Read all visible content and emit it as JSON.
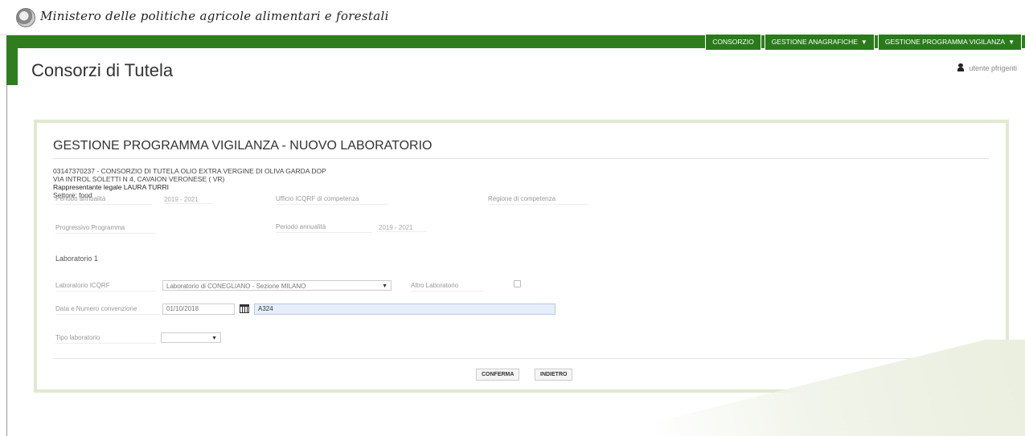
{
  "header": {
    "ministry": "Ministero delle politiche agricole alimentari e forestali",
    "menu": [
      {
        "label": "CONSORZIO",
        "caret": false
      },
      {
        "label": "GESTIONE ANAGRAFICHE",
        "caret": true
      },
      {
        "label": "GESTIONE PROGRAMMA VIGILANZA",
        "caret": true
      }
    ],
    "page_title": "Consorzi di Tutela",
    "user": "utente pfrigenti"
  },
  "panel": {
    "title": "GESTIONE PROGRAMMA VIGILANZA - NUOVO LABORATORIO",
    "info": [
      "03147370237 - CONSORZIO DI TUTELA OLIO EXTRA VERGINE DI OLIVA GARDA DOP",
      "VIA INTROL SOLETTI N 4, CAVAION VERONESE ( VR)",
      "Rappresentante legale LAURA TURRI",
      "Settore: food"
    ],
    "fields": {
      "periodo1_label": "Periodo annualità",
      "periodo1_value": "2019 - 2021",
      "ufficio_label": "Ufficio ICQRF di competenza",
      "regione_label": "Regione di competenza",
      "progressivo_label": "Progressivo Programma",
      "periodo2_label": "Periodo annualità",
      "periodo2_value": "2019 - 2021"
    },
    "lab_section": "Laboratorio 1",
    "lab": {
      "icqrf_label": "Laboratorio ICQRF",
      "icqrf_value": "Laboratorio di CONEGLIANO - Sezione MILANO",
      "altro_label": "Altro Laboratorio",
      "data_label": "Data e Numero convenzione",
      "data_value": "01/10/2018",
      "numero_value": "A324",
      "tipo_label": "Tipo laboratorio",
      "tipo_value": ""
    },
    "buttons": {
      "confirm": "CONFERMA",
      "back": "INDIETRO"
    }
  }
}
